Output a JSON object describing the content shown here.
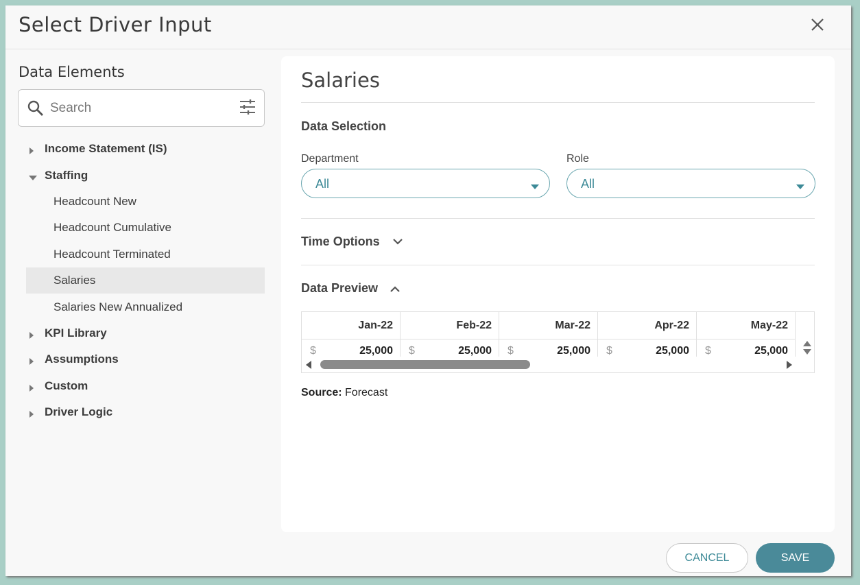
{
  "dialog": {
    "title": "Select Driver Input"
  },
  "left": {
    "title": "Data Elements",
    "search_placeholder": "Search",
    "tree": [
      {
        "label": "Income Statement (IS)",
        "expanded": false
      },
      {
        "label": "Staffing",
        "expanded": true
      },
      {
        "label": "Headcount New"
      },
      {
        "label": "Headcount Cumulative"
      },
      {
        "label": "Headcount Terminated"
      },
      {
        "label": "Salaries",
        "selected": true
      },
      {
        "label": "Salaries New Annualized"
      },
      {
        "label": "KPI Library",
        "expanded": false
      },
      {
        "label": "Assumptions",
        "expanded": false
      },
      {
        "label": "Custom",
        "expanded": false
      },
      {
        "label": "Driver Logic",
        "expanded": false
      }
    ]
  },
  "panel": {
    "title": "Salaries",
    "data_selection": {
      "title": "Data Selection",
      "department": {
        "label": "Department",
        "value": "All"
      },
      "role": {
        "label": "Role",
        "value": "All"
      }
    },
    "time_options": {
      "title": "Time Options"
    },
    "data_preview": {
      "title": "Data Preview",
      "columns": [
        {
          "header": "Jan-22",
          "currency": "$",
          "value": "25,000"
        },
        {
          "header": "Feb-22",
          "currency": "$",
          "value": "25,000"
        },
        {
          "header": "Mar-22",
          "currency": "$",
          "value": "25,000"
        },
        {
          "header": "Apr-22",
          "currency": "$",
          "value": "25,000"
        },
        {
          "header": "May-22",
          "currency": "$",
          "value": "25,000"
        }
      ]
    },
    "source": {
      "label": "Source:",
      "value": "Forecast"
    }
  },
  "footer": {
    "cancel_label": "CANCEL",
    "save_label": "SAVE"
  },
  "colors": {
    "accent": "#3d8a97",
    "save_bg": "#4a8a99",
    "backdrop": "#a9cfc6"
  }
}
